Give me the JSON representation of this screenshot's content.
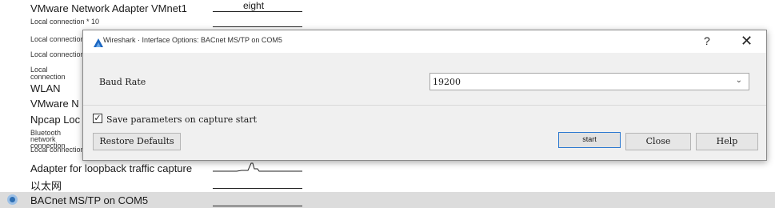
{
  "background_list": {
    "rows": [
      {
        "label": "VMware Network Adapter VMnet1",
        "graph_text": "eight"
      },
      {
        "label": "Local connection * 10"
      },
      {
        "label": "Local connection"
      },
      {
        "label": "Local connection"
      },
      {
        "label": "Local connection"
      },
      {
        "label": "WLAN"
      },
      {
        "label": "VMware N"
      },
      {
        "label": "Npcap Loc"
      },
      {
        "label": "Bluetooth network connection"
      },
      {
        "label": "Local connection"
      },
      {
        "label": "Adapter for loopback traffic capture"
      },
      {
        "label": "以太网"
      },
      {
        "label": "BACnet MS/TP on COM5"
      }
    ]
  },
  "dialog": {
    "title": "Wireshark · Interface Options: BACnet MS/TP on COM5",
    "help_glyph": "?",
    "close_glyph": "✕",
    "baud_rate_label": "Baud Rate",
    "baud_rate_value": "19200",
    "save_params_label": "Save parameters on capture start",
    "save_params_checked": true,
    "buttons": {
      "restore_defaults": "Restore Defaults",
      "start": "start",
      "close": "Close",
      "help": "Help"
    }
  },
  "colors": {
    "selection_bg": "#dcdcdc",
    "focus_border": "#2b78d0",
    "wireshark_fin": "#1a66c2"
  },
  "icons": [
    "wireshark-icon",
    "chevron-down-icon",
    "checkmark-icon",
    "interface-icon"
  ]
}
